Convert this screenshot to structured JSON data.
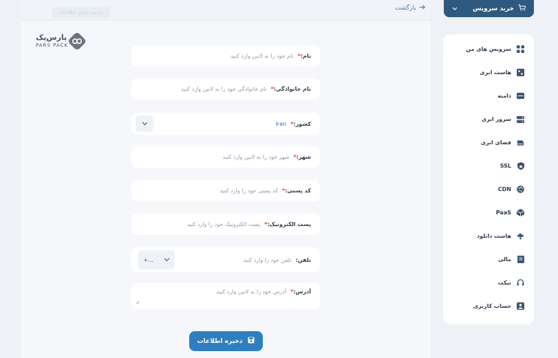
{
  "header": {
    "back_label": "بازگشت",
    "ghost_title": "نیازمند تکمیل اطلاعات"
  },
  "logo": {
    "text": "پارس‌پک",
    "sub": "PARS PACK"
  },
  "form": {
    "first_name": {
      "label": "نام:",
      "placeholder": "نام خود را به لاتین وارد کنید"
    },
    "last_name": {
      "label": "نام خانوادگی:",
      "placeholder": "نام خانوادگی خود را به لاتین وارد کنید"
    },
    "country": {
      "label": "کشور:",
      "value": "Iran"
    },
    "city": {
      "label": "شهر:",
      "placeholder": "شهر خود را به لاتین وارد کنید"
    },
    "postal_code": {
      "label": "کد پستی:",
      "placeholder": "کد پستی خود را وارد کنید"
    },
    "email": {
      "label": "پست الکترونیک:",
      "placeholder": "پست الکترونیک خود را وارد کنید"
    },
    "phone": {
      "label": "تلفن:",
      "placeholder": "تلفن خود را وارد کنید",
      "code": "+..."
    },
    "address": {
      "label": "آدرس:",
      "placeholder": "آدرس خود را به لاتین وارد کنید"
    },
    "required_mark": "*",
    "save_label": "ذخیره اطلاعات"
  },
  "service_button": {
    "label": "خرید سرویس"
  },
  "sidebar": {
    "items": [
      {
        "label": "سرویس های من",
        "icon": "grid-icon"
      },
      {
        "label": "هاست ابری",
        "icon": "cloud-host-icon"
      },
      {
        "label": "دامنه",
        "icon": "domain-icon"
      },
      {
        "label": "سرور ابری",
        "icon": "server-icon"
      },
      {
        "label": "فضای ابری",
        "icon": "storage-icon"
      },
      {
        "label": "SSL",
        "icon": "lock-icon"
      },
      {
        "label": "CDN",
        "icon": "globe-icon"
      },
      {
        "label": "PaaS",
        "icon": "cube-icon"
      },
      {
        "label": "هاست دانلود",
        "icon": "download-cloud-icon"
      },
      {
        "label": "مالی",
        "icon": "wallet-icon"
      },
      {
        "label": "تیکت",
        "icon": "headset-icon"
      },
      {
        "label": "حساب کاربری",
        "icon": "user-icon"
      }
    ]
  },
  "colors": {
    "accent": "#2f7ec0",
    "sidebar_button": "#2d5a7e",
    "required": "#e23b3b"
  }
}
